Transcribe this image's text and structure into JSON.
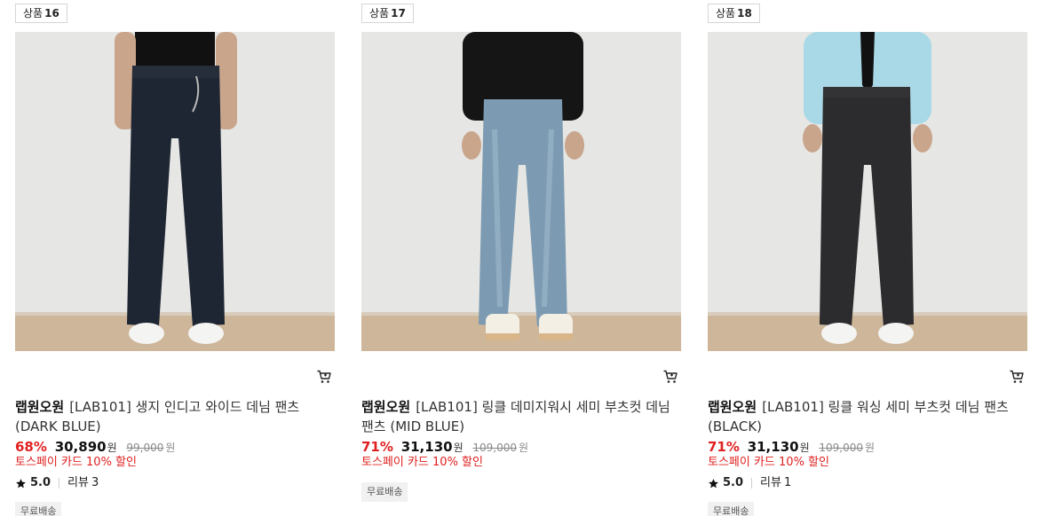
{
  "currency_unit": "원",
  "rank_label": "상품",
  "products": [
    {
      "rank": "16",
      "brand": "랩원오원",
      "name": "[LAB101] 생지 인디고 와이드 데님 팬츠 (DARK BLUE)",
      "discount_rate": "68%",
      "price": "30,890",
      "original_price": "99,000",
      "promo": "토스페이 카드 10% 할인",
      "rating": "5.0",
      "review_label": "리뷰",
      "review_count": "3",
      "tag": "무료배송",
      "colors": {
        "jeans": "#1f2633",
        "top": "#111111",
        "shoes": "#f4f4f2",
        "wall": "#e6e6e4",
        "floor": "#cdb69a"
      }
    },
    {
      "rank": "17",
      "brand": "랩원오원",
      "name": "[LAB101] 링클 데미지워시 세미 부츠컷 데님 팬츠 (MID BLUE)",
      "discount_rate": "71%",
      "price": "31,130",
      "original_price": "109,000",
      "promo": "토스페이 카드 10% 할인",
      "rating": "",
      "review_label": "",
      "review_count": "",
      "tag": "무료배송",
      "colors": {
        "jeans": "#7c9bb2",
        "top": "#151515",
        "shoes": "#f3efe4",
        "wall": "#e6e6e4",
        "floor": "#cdb69a"
      }
    },
    {
      "rank": "18",
      "brand": "랩원오원",
      "name": "[LAB101] 링클 워싱 세미 부츠컷 데님 팬츠 (BLACK)",
      "discount_rate": "71%",
      "price": "31,130",
      "original_price": "109,000",
      "promo": "토스페이 카드 10% 할인",
      "rating": "5.0",
      "review_label": "리뷰",
      "review_count": "1",
      "tag": "무료배송",
      "colors": {
        "jeans": "#2c2c2e",
        "top": "#a9d9e6",
        "shoes": "#f4f4f2",
        "wall": "#e6e6e4",
        "floor": "#cdb69a"
      }
    }
  ],
  "icons": {
    "cart": "cart-icon",
    "star": "star-icon"
  }
}
